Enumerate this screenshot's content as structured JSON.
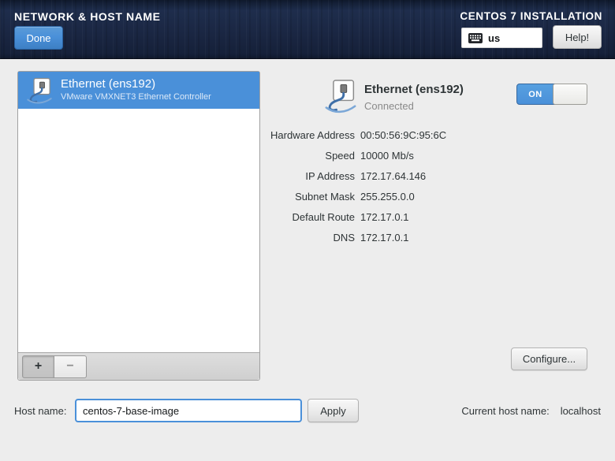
{
  "header": {
    "title": "NETWORK & HOST NAME",
    "done_label": "Done",
    "product": "CENTOS 7 INSTALLATION",
    "keyboard_layout": "us",
    "help_label": "Help!"
  },
  "device_list": {
    "items": [
      {
        "name": "Ethernet (ens192)",
        "description": "VMware VMXNET3 Ethernet Controller",
        "selected": true
      }
    ],
    "add_label": "+",
    "remove_label": "−"
  },
  "detail": {
    "name": "Ethernet (ens192)",
    "status": "Connected",
    "toggle_label": "ON",
    "toggle_state": "on",
    "fields": [
      {
        "label": "Hardware Address",
        "value": "00:50:56:9C:95:6C"
      },
      {
        "label": "Speed",
        "value": "10000 Mb/s"
      },
      {
        "label": "IP Address",
        "value": "172.17.64.146"
      },
      {
        "label": "Subnet Mask",
        "value": "255.255.0.0"
      },
      {
        "label": "Default Route",
        "value": "172.17.0.1"
      },
      {
        "label": "DNS",
        "value": "172.17.0.1"
      }
    ],
    "configure_label": "Configure..."
  },
  "hostname": {
    "label": "Host name:",
    "value": "centos-7-base-image",
    "apply_label": "Apply",
    "current_label": "Current host name:",
    "current_value": "localhost"
  },
  "colors": {
    "accent_blue": "#4a90d9",
    "header_bg": "#1a2642",
    "content_bg": "#ededed",
    "selection_bg": "#4a90d9"
  }
}
